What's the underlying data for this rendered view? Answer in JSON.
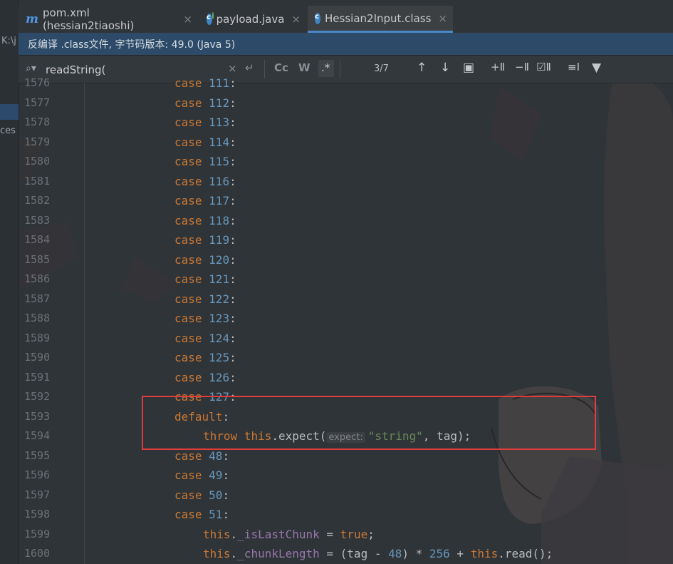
{
  "left_panel": {
    "path_fragment": "K:\\j",
    "item_fragment": "ces"
  },
  "tabs": [
    {
      "label": "pom.xml (hessian2tiaoshi)",
      "icon": "maven-icon",
      "active": false
    },
    {
      "label": "payload.java",
      "icon": "java-class-icon",
      "active": false
    },
    {
      "label": "Hessian2Input.class",
      "icon": "class-file-icon",
      "active": true
    }
  ],
  "tab_close_glyph": "×",
  "banner": {
    "text": "反编译 .class文件, 字节码版本: 49.0 (Java 5)"
  },
  "search": {
    "value": "readString(",
    "placeholder": "",
    "match_count": "3/7",
    "clear_glyph": "×",
    "match_case_label": "Cc",
    "words_label": "W",
    "regex_label": ".*"
  },
  "line_numbers": [
    "1576",
    "1577",
    "1578",
    "1579",
    "1580",
    "1581",
    "1582",
    "1583",
    "1584",
    "1585",
    "1586",
    "1587",
    "1588",
    "1589",
    "1590",
    "1591",
    "1592",
    "1593",
    "1594",
    "1595",
    "1596",
    "1597",
    "1598",
    "1599",
    "1600"
  ],
  "code_lines": [
    {
      "kind": "case",
      "value": "111"
    },
    {
      "kind": "case",
      "value": "112"
    },
    {
      "kind": "case",
      "value": "113"
    },
    {
      "kind": "case",
      "value": "114"
    },
    {
      "kind": "case",
      "value": "115"
    },
    {
      "kind": "case",
      "value": "116"
    },
    {
      "kind": "case",
      "value": "117"
    },
    {
      "kind": "case",
      "value": "118"
    },
    {
      "kind": "case",
      "value": "119"
    },
    {
      "kind": "case",
      "value": "120"
    },
    {
      "kind": "case",
      "value": "121"
    },
    {
      "kind": "case",
      "value": "122"
    },
    {
      "kind": "case",
      "value": "123"
    },
    {
      "kind": "case",
      "value": "124"
    },
    {
      "kind": "case",
      "value": "125"
    },
    {
      "kind": "case",
      "value": "126"
    },
    {
      "kind": "case",
      "value": "127"
    },
    {
      "kind": "default"
    },
    {
      "kind": "throw"
    },
    {
      "kind": "case",
      "value": "48"
    },
    {
      "kind": "case",
      "value": "49"
    },
    {
      "kind": "case",
      "value": "50"
    },
    {
      "kind": "case",
      "value": "51"
    },
    {
      "kind": "assign1"
    },
    {
      "kind": "assign2"
    }
  ],
  "tokens": {
    "case": "case",
    "colon": ":",
    "default": "default",
    "throw": "throw",
    "this": "this",
    "expect_call": ".expect(",
    "param_hint": "expect:",
    "string_arg": "\"string\"",
    "tag_arg": ", tag);",
    "is_last_chunk": "_isLastChunk",
    "true_kw": "true",
    "chunk_length": "_chunkLength",
    "read_call": ".read();",
    "dot": "."
  },
  "colors": {
    "keyword": "#cc7832",
    "number": "#6897bb",
    "string": "#6a8759",
    "field": "#9876aa",
    "highlight_box": "#e03c3c",
    "banner_bg": "#2d4b68",
    "active_tab_underline": "#4a88c7"
  }
}
